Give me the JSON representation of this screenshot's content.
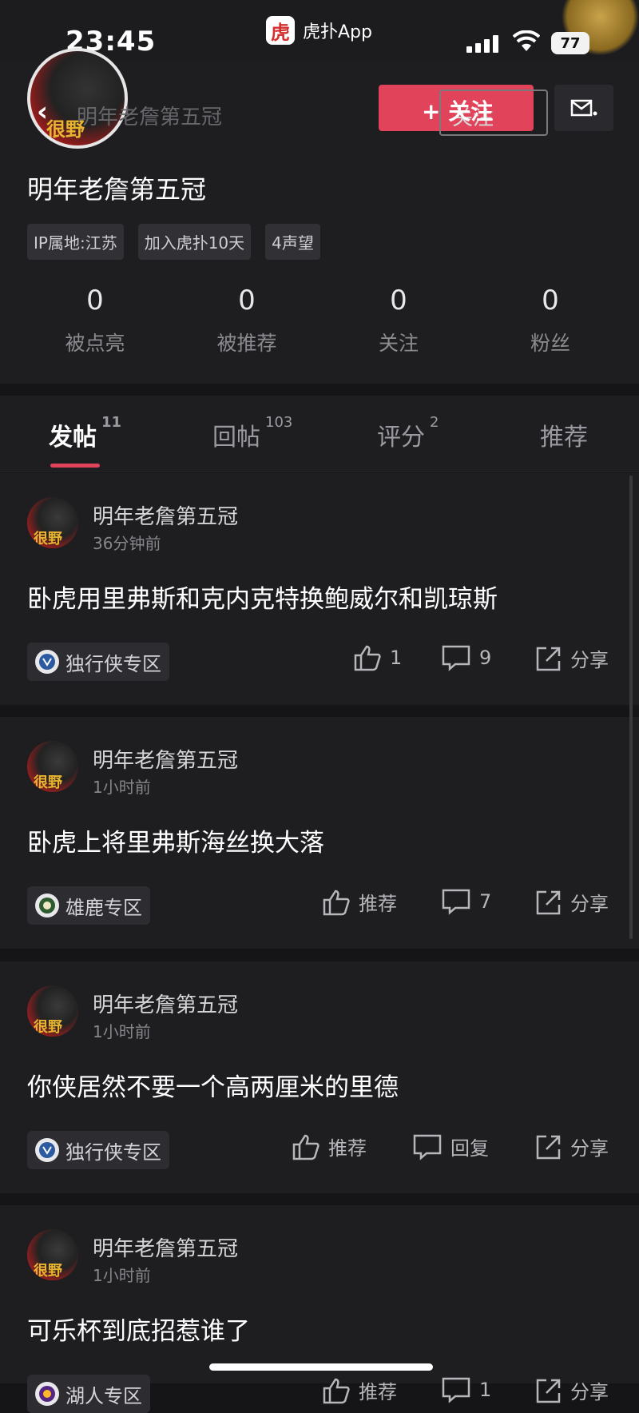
{
  "status_bar": {
    "time": "23:45",
    "app_name": "虎扑App",
    "app_logo": "虎",
    "battery": "77"
  },
  "header": {
    "back_icon": "‹",
    "title": "明年老詹第五冠",
    "follow_label": "+ 关注",
    "follow_label_ghost": "关注",
    "mail_icon": "mail-icon"
  },
  "profile": {
    "avatar_text": "很野",
    "name": "明年老詹第五冠",
    "tags": [
      "IP属地:江苏",
      "加入虎扑10天",
      "4声望"
    ],
    "stats": [
      {
        "value": "0",
        "label": "被点亮"
      },
      {
        "value": "0",
        "label": "被推荐"
      },
      {
        "value": "0",
        "label": "关注"
      },
      {
        "value": "0",
        "label": "粉丝"
      }
    ]
  },
  "tabs": [
    {
      "label": "发帖",
      "count": "11"
    },
    {
      "label": "回帖",
      "count": "103"
    },
    {
      "label": "评分",
      "count": "2"
    },
    {
      "label": "推荐",
      "count": ""
    }
  ],
  "posts": [
    {
      "author": "明年老詹第五冠",
      "time": "36分钟前",
      "title": "卧虎用里弗斯和克内克特换鲍威尔和凯琼斯",
      "zone": "独行侠专区",
      "like": "1",
      "comment": "9",
      "share": "分享"
    },
    {
      "author": "明年老詹第五冠",
      "time": "1小时前",
      "title": "卧虎上将里弗斯海丝换大落",
      "zone": "雄鹿专区",
      "like": "推荐",
      "comment": "7",
      "share": "分享"
    },
    {
      "author": "明年老詹第五冠",
      "time": "1小时前",
      "title": "你侠居然不要一个高两厘米的里德",
      "zone": "独行侠专区",
      "like": "推荐",
      "comment": "回复",
      "share": "分享"
    },
    {
      "author": "明年老詹第五冠",
      "time": "1小时前",
      "title": "可乐杯到底招惹谁了",
      "zone": "湖人专区",
      "like": "推荐",
      "comment": "1",
      "share": "分享"
    }
  ]
}
